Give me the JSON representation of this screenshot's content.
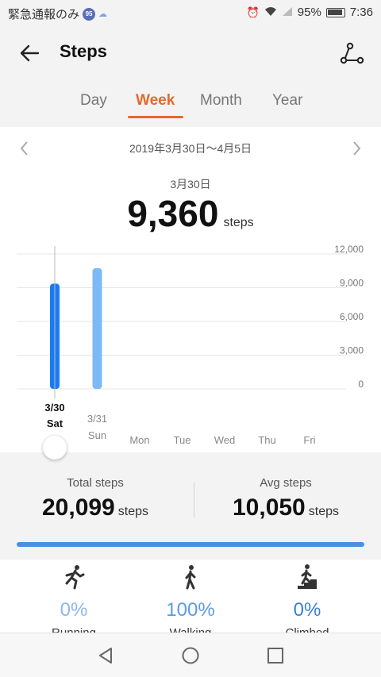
{
  "status_bar": {
    "carrier_text": "緊急通報のみ",
    "badge": "95",
    "battery_text": "95%",
    "time": "7:36"
  },
  "header": {
    "title": "Steps"
  },
  "tabs": [
    {
      "label": "Day",
      "active": false
    },
    {
      "label": "Week",
      "active": true
    },
    {
      "label": "Month",
      "active": false
    },
    {
      "label": "Year",
      "active": false
    }
  ],
  "range": {
    "text": "2019年3月30日～4月5日"
  },
  "selected": {
    "date_label": "3月30日",
    "value": "9,360",
    "unit": "steps"
  },
  "chart_data": {
    "type": "bar",
    "categories": [
      "3/30",
      "3/31",
      "",
      "",
      "",
      "",
      ""
    ],
    "day_names": [
      "Sat",
      "Sun",
      "Mon",
      "Tue",
      "Wed",
      "Thu",
      "Fri"
    ],
    "values": [
      9360,
      10739,
      0,
      0,
      0,
      0,
      0
    ],
    "selected_index": 0,
    "yticks": [
      "12,000",
      "9,000",
      "6,000",
      "3,000",
      "0"
    ],
    "ylim": [
      0,
      12000
    ],
    "grid": true,
    "colors": {
      "selected": "#1a7cf0",
      "normal": "#7db9f4"
    }
  },
  "totals": {
    "total_label": "Total steps",
    "total_value": "20,099",
    "avg_label": "Avg steps",
    "avg_value": "10,050",
    "unit": "steps"
  },
  "activities": [
    {
      "icon": "running-icon",
      "pct": "0%",
      "label": "Running",
      "color": "#8cb8ea"
    },
    {
      "icon": "walking-icon",
      "pct": "100%",
      "label": "Walking",
      "color": "#5b9be6"
    },
    {
      "icon": "climbing-icon",
      "pct": "0%",
      "label": "Climbed",
      "color": "#3b7fd6"
    }
  ],
  "nav": {
    "back": "back-triangle-icon",
    "home": "home-circle-icon",
    "recent": "recent-square-icon"
  }
}
